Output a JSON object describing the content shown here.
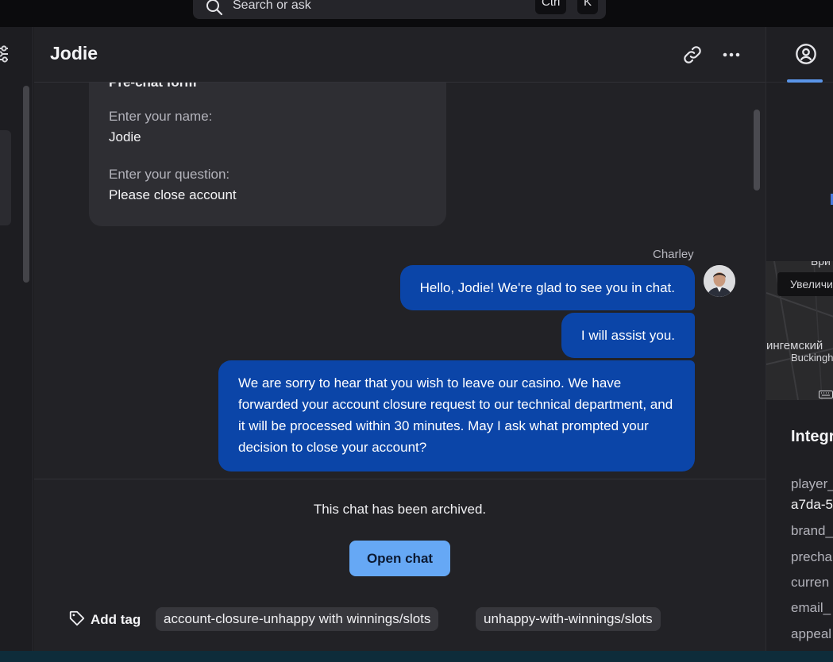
{
  "search": {
    "placeholder": "Search or ask",
    "shortcut_keys": [
      "Ctrl",
      "K"
    ]
  },
  "chat": {
    "title": "Jodie",
    "prechat_form": {
      "title": "Pre-chat form",
      "fields": [
        {
          "label": "Enter your name:",
          "value": "Jodie"
        },
        {
          "label": "Enter your question:",
          "value": "Please close account"
        }
      ]
    },
    "agent_name": "Charley",
    "messages": [
      "Hello, Jodie! We're glad to see you in chat.",
      "I will assist you.",
      "We are sorry to hear that you wish to leave our casino. We have forwarded your account closure request to our technical department, and it will be processed within 30 minutes. May I ask what prompted your decision to close your account?"
    ],
    "archived_notice": "This chat has been archived.",
    "open_chat_label": "Open chat",
    "add_tag_label": "Add tag",
    "tags": [
      "account-closure-unhappy with winnings/slots",
      "unhappy-with-winnings/slots"
    ]
  },
  "right_panel": {
    "map": {
      "zoom_label": "Увеличить",
      "labels": [
        "Бри",
        "ингемский",
        "Buckingh"
      ]
    },
    "integrations_title": "Integr",
    "fields": [
      "player_",
      "brand_",
      "precha",
      "curren",
      "email_",
      "appeal"
    ],
    "player_value": "a7da-5"
  },
  "icons": {
    "search": "search-icon",
    "filters": "sliders-icon",
    "link": "link-icon",
    "more": "more-horizontal-icon",
    "tag": "tag-icon",
    "profile": "user-circle-icon"
  },
  "colors": {
    "accent_bubble": "#0b45a8",
    "button_primary": "#66a8f5",
    "tab_active": "#5a95e8"
  }
}
